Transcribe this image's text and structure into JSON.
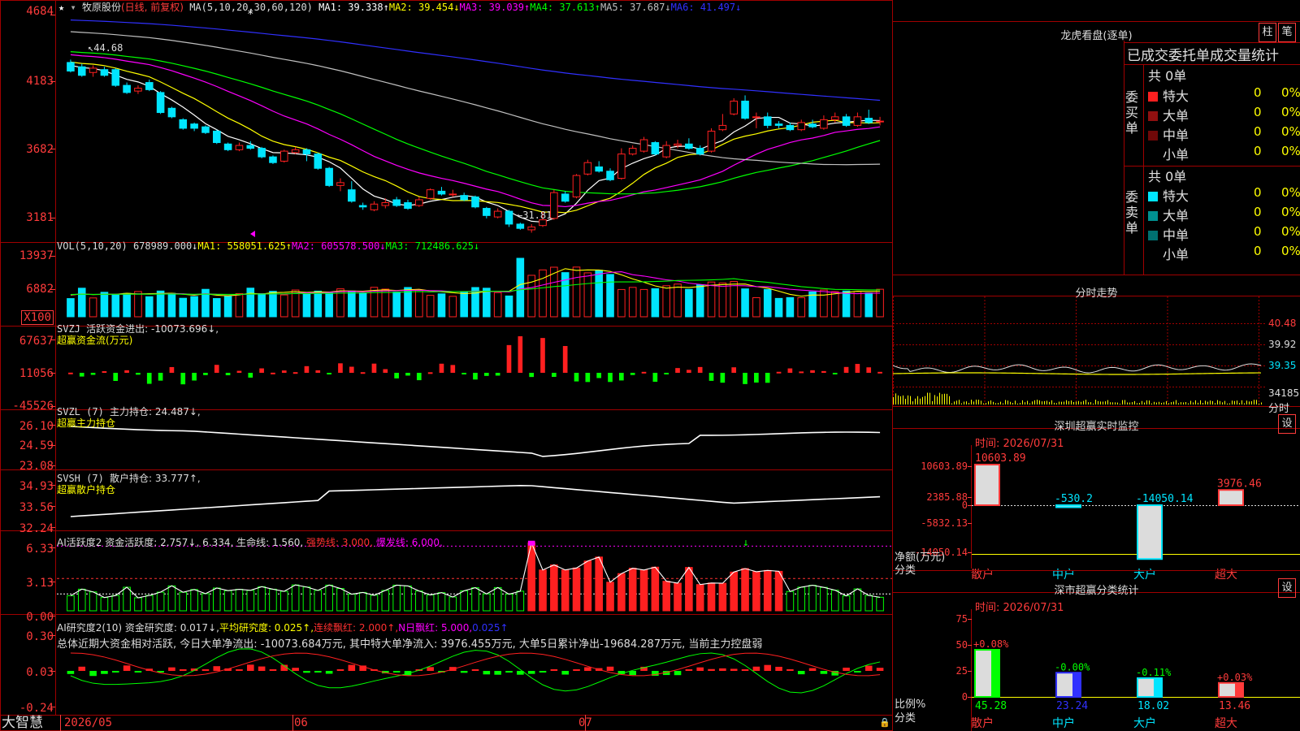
{
  "app": {
    "name": "大智慧"
  },
  "stock": {
    "name": "牧原股份",
    "mode": "(日线, 前复权)"
  },
  "colors": {
    "up": "#ff2020",
    "down": "#00e5ff",
    "ma1": "#ffffff",
    "ma2": "#ffff00",
    "ma3": "#ff00ff",
    "ma4": "#00ff00",
    "ma5": "#c0c0c0",
    "ma6": "#3030ff",
    "grid": "#a00000"
  },
  "kline": {
    "legend": {
      "period": "MA(5,10,20,30,60,120)",
      "ma1": "MA1: 39.338↑",
      "ma2": "MA2: 39.454↓",
      "ma3": "MA3: 39.039↑",
      "ma4": "MA4: 37.613↑",
      "ma5": "MA5: 37.687↓",
      "ma6": "MA6: 41.497↓"
    },
    "yaxis": [
      "4684",
      "4183",
      "3682",
      "3181"
    ],
    "ylim": [
      3130,
      4720
    ],
    "high_label": "44.68",
    "low_label": "31.81",
    "candles": [
      [
        4340,
        4280,
        4360,
        4270
      ],
      [
        4310,
        4250,
        4330,
        4240
      ],
      [
        4270,
        4300,
        4320,
        4240
      ],
      [
        4290,
        4250,
        4310,
        4240
      ],
      [
        4290,
        4180,
        4300,
        4170
      ],
      [
        4180,
        4130,
        4200,
        4120
      ],
      [
        4140,
        4160,
        4180,
        4120
      ],
      [
        4200,
        4150,
        4220,
        4140
      ],
      [
        4130,
        3990,
        4140,
        3980
      ],
      [
        4020,
        3960,
        4030,
        3950
      ],
      [
        3940,
        3880,
        3950,
        3870
      ],
      [
        3910,
        3880,
        3920,
        3860
      ],
      [
        3890,
        3850,
        3900,
        3840
      ],
      [
        3860,
        3780,
        3870,
        3770
      ],
      [
        3770,
        3730,
        3780,
        3720
      ],
      [
        3730,
        3760,
        3780,
        3720
      ],
      [
        3760,
        3740,
        3790,
        3730
      ],
      [
        3740,
        3680,
        3750,
        3670
      ],
      [
        3680,
        3640,
        3690,
        3630
      ],
      [
        3650,
        3720,
        3730,
        3640
      ],
      [
        3710,
        3730,
        3750,
        3700
      ],
      [
        3730,
        3700,
        3740,
        3650
      ],
      [
        3700,
        3600,
        3710,
        3590
      ],
      [
        3600,
        3480,
        3610,
        3470
      ],
      [
        3480,
        3500,
        3530,
        3440
      ],
      [
        3450,
        3370,
        3510,
        3360
      ],
      [
        3340,
        3330,
        3360,
        3310
      ],
      [
        3310,
        3350,
        3370,
        3300
      ],
      [
        3340,
        3360,
        3390,
        3320
      ],
      [
        3380,
        3340,
        3400,
        3330
      ],
      [
        3360,
        3320,
        3380,
        3310
      ],
      [
        3340,
        3380,
        3400,
        3330
      ],
      [
        3390,
        3450,
        3460,
        3380
      ],
      [
        3440,
        3420,
        3470,
        3410
      ],
      [
        3420,
        3420,
        3450,
        3400
      ],
      [
        3410,
        3380,
        3430,
        3370
      ],
      [
        3400,
        3330,
        3410,
        3320
      ],
      [
        3320,
        3270,
        3330,
        3250
      ],
      [
        3260,
        3300,
        3320,
        3250
      ],
      [
        3300,
        3210,
        3310,
        3190
      ],
      [
        3210,
        3180,
        3220,
        3170
      ],
      [
        3170,
        3190,
        3210,
        3150
      ],
      [
        3200,
        3240,
        3300,
        3190
      ],
      [
        3250,
        3430,
        3450,
        3240
      ],
      [
        3420,
        3370,
        3440,
        3360
      ],
      [
        3400,
        3550,
        3560,
        3390
      ],
      [
        3560,
        3640,
        3660,
        3550
      ],
      [
        3610,
        3580,
        3650,
        3570
      ],
      [
        3580,
        3520,
        3600,
        3510
      ],
      [
        3530,
        3700,
        3740,
        3520
      ],
      [
        3700,
        3740,
        3760,
        3690
      ],
      [
        3720,
        3800,
        3820,
        3710
      ],
      [
        3780,
        3700,
        3790,
        3690
      ],
      [
        3680,
        3760,
        3790,
        3670
      ],
      [
        3760,
        3770,
        3800,
        3740
      ],
      [
        3770,
        3740,
        3810,
        3730
      ],
      [
        3740,
        3700,
        3760,
        3690
      ],
      [
        3720,
        3860,
        3880,
        3710
      ],
      [
        3870,
        3900,
        3980,
        3860
      ],
      [
        3980,
        4070,
        4090,
        3970
      ],
      [
        4070,
        3950,
        4110,
        3940
      ],
      [
        3960,
        3960,
        3990,
        3880
      ],
      [
        3960,
        3900,
        3990,
        3880
      ],
      [
        3910,
        3900,
        3930,
        3880
      ],
      [
        3900,
        3870,
        3920,
        3860
      ],
      [
        3870,
        3920,
        3940,
        3860
      ],
      [
        3910,
        3890,
        3940,
        3880
      ],
      [
        3880,
        3940,
        3970,
        3870
      ],
      [
        3940,
        3960,
        3990,
        3920
      ],
      [
        3960,
        3900,
        3980,
        3890
      ],
      [
        3900,
        3960,
        3990,
        3890
      ],
      [
        3950,
        3920,
        4010,
        3910
      ],
      [
        3930,
        3930,
        3960,
        3900
      ]
    ]
  },
  "vol": {
    "legend": {
      "name": "VOL(5,10,20)",
      "value": "678989.000↓",
      "ma1": "MA1: 558051.625↑",
      "ma2": "MA2: 605578.500↓",
      "ma3": "MA3: 712486.625↓"
    },
    "yaxis": [
      "13937",
      "6882"
    ],
    "unit": "X100",
    "max": 15000
  },
  "svzj": {
    "legend": {
      "name": "SVZJ",
      "label": "活跃资金进出: -10073.696↓,",
      "sub": "超赢资金流(万元)"
    },
    "yaxis": [
      "67637",
      "11056",
      "-45526"
    ]
  },
  "svzl": {
    "legend": {
      "name": "SVZL (7)",
      "label": "主力持仓: 24.487↓,",
      "sub": "超赢主力持仓"
    },
    "yaxis": [
      "26.10",
      "24.59",
      "23.08"
    ]
  },
  "svsh": {
    "legend": {
      "name": "SVSH (7)",
      "label": "散户持仓: 33.777↑,",
      "sub": "超赢散户持仓"
    },
    "yaxis": [
      "34.93",
      "33.56",
      "32.24"
    ]
  },
  "aihy": {
    "legend": {
      "name": "AI活跃度2",
      "label": "资金活跃度: 2.757↓, 6.334,",
      "life": "生命线: 1.560,",
      "strong": "强势线: 3.000,",
      "burst": "爆发线: 6.000,"
    },
    "yaxis": [
      "6.33",
      "3.13",
      "0.00"
    ]
  },
  "aiyj": {
    "legend": {
      "name": "AI研究度2(10)",
      "label": "资金研究度: 0.017↓,",
      "avg": "平均研究度: 0.025↑,",
      "lian": "连续飘红: 2.000↑,",
      "nri": "N日飘红: 5.000,",
      "tail": "0.025↑"
    },
    "comment": "总体近期大资金相对活跃, 今日大单净流出: -10073.684万元, 其中特大单净流入: 3976.455万元, 大单5日累计净出-19684.287万元, 当前主力控盘弱",
    "yaxis": [
      "0.30",
      "0.03",
      "-0.24"
    ]
  },
  "xaxis": {
    "labels": [
      "2026/05",
      "06",
      "07"
    ]
  },
  "right": {
    "longhu": {
      "title": "龙虎看盘(逐单)",
      "tab1": "柱",
      "tab2": "笔"
    },
    "table_title": "已成交委托单成交量统计",
    "buy": {
      "label": "委买单",
      "total": "共 0单",
      "rows": [
        {
          "name": "特大",
          "val": "0",
          "pct": "0%",
          "color": "#ff2020"
        },
        {
          "name": "大单",
          "val": "0",
          "pct": "0%",
          "color": "#901010"
        },
        {
          "name": "中单",
          "val": "0",
          "pct": "0%",
          "color": "#700808"
        },
        {
          "name": "小单",
          "val": "0",
          "pct": "0%",
          "color": ""
        }
      ]
    },
    "sell": {
      "label": "委卖单",
      "total": "共 0单",
      "rows": [
        {
          "name": "特大",
          "val": "0",
          "pct": "0%",
          "color": "#00e5ff"
        },
        {
          "name": "大单",
          "val": "0",
          "pct": "0%",
          "color": "#009090"
        },
        {
          "name": "中单",
          "val": "0",
          "pct": "0%",
          "color": "#007070"
        },
        {
          "name": "小单",
          "val": "0",
          "pct": "0%",
          "color": ""
        }
      ]
    },
    "fenshi": {
      "title": "分时走势",
      "yaxis": [
        "40.48",
        "39.92",
        "39.35",
        "34185"
      ],
      "unit": "分时"
    },
    "monitor": {
      "title": "深圳超赢实时监控",
      "button": "设",
      "time": "时间: 2026/07/31",
      "yaxis": [
        "10603.89",
        "2385.88",
        "0",
        "-5832.13",
        "-14050.14"
      ],
      "ylabel": "净额(万元)",
      "ylabel2": "分类",
      "bars": [
        {
          "cat": "散户",
          "value": 10603.89,
          "label": "10603.89"
        },
        {
          "cat": "中户",
          "value": -530.2,
          "label": "-530.2"
        },
        {
          "cat": "大户",
          "value": -14050.14,
          "label": "-14050.14"
        },
        {
          "cat": "超大",
          "value": 3976.46,
          "label": "3976.46"
        }
      ]
    },
    "classify": {
      "title": "深市超赢分类统计",
      "button": "设",
      "time": "时间: 2026/07/31",
      "yaxis": [
        "75",
        "50",
        "25",
        "0"
      ],
      "ylabel": "比例%",
      "ylabel2": "分类",
      "bars": [
        {
          "cat": "散户",
          "value": 45.28,
          "change": "+0.08%"
        },
        {
          "cat": "中户",
          "value": 23.24,
          "change": "-0.00%"
        },
        {
          "cat": "大户",
          "value": 18.02,
          "change": "-0.11%"
        },
        {
          "cat": "超大",
          "value": 13.46,
          "change": "+0.03%"
        }
      ]
    }
  }
}
